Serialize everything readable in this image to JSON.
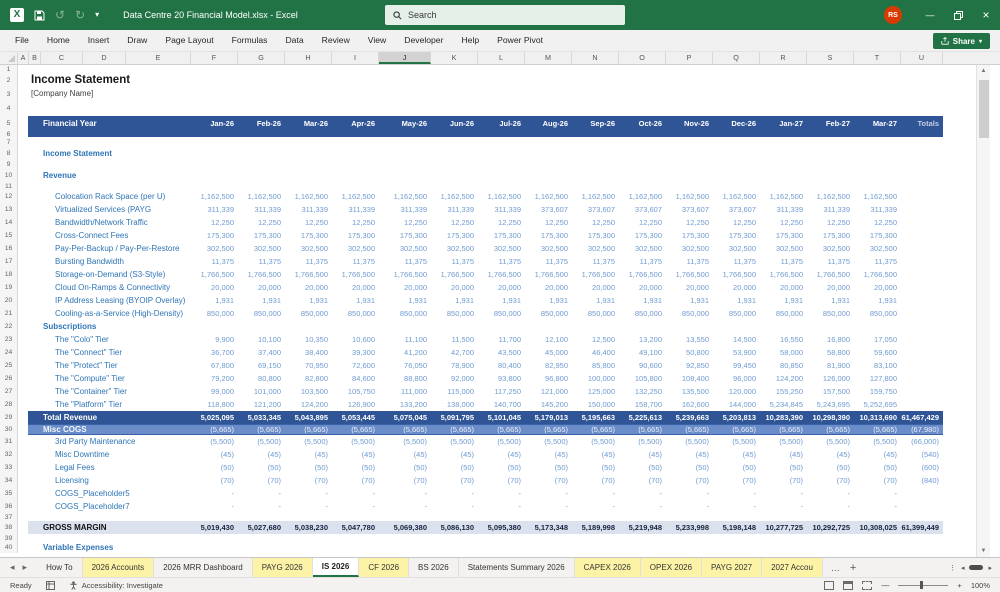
{
  "titlebar": {
    "title": "Data Centre 20 Financial Model.xlsx  -  Excel",
    "search_label": "Search",
    "avatar_initials": "RS"
  },
  "menubar": {
    "items": [
      "File",
      "Home",
      "Insert",
      "Draw",
      "Page Layout",
      "Formulas",
      "Data",
      "Review",
      "View",
      "Developer",
      "Help",
      "Power Pivot"
    ],
    "share_label": "Share"
  },
  "columns": {
    "letters": [
      "A",
      "B",
      "C",
      "D",
      "E",
      "F",
      "G",
      "H",
      "I",
      "J",
      "K",
      "L",
      "M",
      "N",
      "O",
      "P",
      "Q",
      "R",
      "S",
      "T",
      "U"
    ],
    "selected": "J"
  },
  "colors": {
    "excel_green": "#217346",
    "header_blue": "#2F5597",
    "cogs_fill": "#6A8CC8",
    "gross_margin_fill": "#DBE2EE",
    "section_text": "#2E75B6",
    "value_text": "#6F9BD2",
    "tab_yellow": "#FCF3A6",
    "avatar_orange": "#D83B01"
  },
  "glyphs": {
    "undo": "↺",
    "redo": "↻",
    "caret": "▾",
    "minimize": "—",
    "close": "×",
    "scroll_up": "▲",
    "scroll_down": "▼",
    "tab_left": "◂",
    "tab_right": "▸",
    "more_tabs": "…",
    "add_sheet": "+",
    "dots": "⋮",
    "zoom_out": "—",
    "zoom_in": "+"
  },
  "sheet": {
    "header": {
      "label": "Financial Year",
      "months": [
        "Jan-26",
        "Feb-26",
        "Mar-26",
        "Apr-26",
        "May-26",
        "Jun-26",
        "Jul-26",
        "Aug-26",
        "Sep-26",
        "Oct-26",
        "Nov-26",
        "Dec-26",
        "Jan-27",
        "Feb-27",
        "Mar-27"
      ],
      "totals_label": "Totals"
    },
    "rows": [
      {
        "n": 1,
        "type": "empty"
      },
      {
        "n": 2,
        "type": "title",
        "label": "Income Statement"
      },
      {
        "n": 3,
        "type": "subtitle",
        "label": "[Company Name]"
      },
      {
        "n": 4,
        "type": "empty"
      },
      {
        "n": 5,
        "type": "monthheader",
        "label": "Financial Year"
      },
      {
        "n": 6,
        "type": "band"
      },
      {
        "n": 7,
        "type": "empty"
      },
      {
        "n": 8,
        "type": "section",
        "label": "Income Statement"
      },
      {
        "n": 9,
        "type": "empty"
      },
      {
        "n": 10,
        "type": "section",
        "label": "Revenue"
      },
      {
        "n": 11,
        "type": "empty"
      },
      {
        "n": 12,
        "type": "item",
        "label": "Colocation Rack Space (per U)",
        "values": [
          "1,162,500",
          "1,162,500",
          "1,162,500",
          "1,162,500",
          "1,162,500",
          "1,162,500",
          "1,162,500",
          "1,162,500",
          "1,162,500",
          "1,162,500",
          "1,162,500",
          "1,162,500",
          "1,162,500",
          "1,162,500",
          "1,162,500"
        ],
        "total": ""
      },
      {
        "n": 13,
        "type": "item",
        "label": "Virtualized Services (PAYG",
        "values": [
          "311,339",
          "311,339",
          "311,339",
          "311,339",
          "311,339",
          "311,339",
          "311,339",
          "373,607",
          "373,607",
          "373,607",
          "373,607",
          "373,607",
          "311,339",
          "311,339",
          "311,339"
        ],
        "total": ""
      },
      {
        "n": 14,
        "type": "item",
        "label": "Bandwidth/Network Traffic",
        "values": [
          "12,250",
          "12,250",
          "12,250",
          "12,250",
          "12,250",
          "12,250",
          "12,250",
          "12,250",
          "12,250",
          "12,250",
          "12,250",
          "12,250",
          "12,250",
          "12,250",
          "12,250"
        ],
        "total": ""
      },
      {
        "n": 15,
        "type": "item",
        "label": "Cross-Connect Fees",
        "values": [
          "175,300",
          "175,300",
          "175,300",
          "175,300",
          "175,300",
          "175,300",
          "175,300",
          "175,300",
          "175,300",
          "175,300",
          "175,300",
          "175,300",
          "175,300",
          "175,300",
          "175,300"
        ],
        "total": ""
      },
      {
        "n": 16,
        "type": "item",
        "label": "Pay-Per-Backup / Pay-Per-Restore",
        "values": [
          "302,500",
          "302,500",
          "302,500",
          "302,500",
          "302,500",
          "302,500",
          "302,500",
          "302,500",
          "302,500",
          "302,500",
          "302,500",
          "302,500",
          "302,500",
          "302,500",
          "302,500"
        ],
        "total": ""
      },
      {
        "n": 17,
        "type": "item",
        "label": "Bursting Bandwidth",
        "values": [
          "11,375",
          "11,375",
          "11,375",
          "11,375",
          "11,375",
          "11,375",
          "11,375",
          "11,375",
          "11,375",
          "11,375",
          "11,375",
          "11,375",
          "11,375",
          "11,375",
          "11,375"
        ],
        "total": ""
      },
      {
        "n": 18,
        "type": "item",
        "label": "Storage-on-Demand (S3-Style)",
        "values": [
          "1,766,500",
          "1,766,500",
          "1,766,500",
          "1,766,500",
          "1,766,500",
          "1,766,500",
          "1,766,500",
          "1,766,500",
          "1,766,500",
          "1,766,500",
          "1,766,500",
          "1,766,500",
          "1,766,500",
          "1,766,500",
          "1,766,500"
        ],
        "total": ""
      },
      {
        "n": 19,
        "type": "item",
        "label": "Cloud On-Ramps & Connectivity",
        "values": [
          "20,000",
          "20,000",
          "20,000",
          "20,000",
          "20,000",
          "20,000",
          "20,000",
          "20,000",
          "20,000",
          "20,000",
          "20,000",
          "20,000",
          "20,000",
          "20,000",
          "20,000"
        ],
        "total": ""
      },
      {
        "n": 20,
        "type": "item",
        "label": "IP Address Leasing (BYOIP Overlay)",
        "values": [
          "1,931",
          "1,931",
          "1,931",
          "1,931",
          "1,931",
          "1,931",
          "1,931",
          "1,931",
          "1,931",
          "1,931",
          "1,931",
          "1,931",
          "1,931",
          "1,931",
          "1,931"
        ],
        "total": ""
      },
      {
        "n": 21,
        "type": "item",
        "label": "Cooling-as-a-Service (High-Density)",
        "values": [
          "850,000",
          "850,000",
          "850,000",
          "850,000",
          "850,000",
          "850,000",
          "850,000",
          "850,000",
          "850,000",
          "850,000",
          "850,000",
          "850,000",
          "850,000",
          "850,000",
          "850,000"
        ],
        "total": ""
      },
      {
        "n": 22,
        "type": "section",
        "label": "Subscriptions"
      },
      {
        "n": 23,
        "type": "item",
        "label": "The \"Colo\" Tier",
        "values": [
          "9,900",
          "10,100",
          "10,350",
          "10,600",
          "11,100",
          "11,500",
          "11,700",
          "12,100",
          "12,500",
          "13,200",
          "13,550",
          "14,500",
          "16,550",
          "16,800",
          "17,050"
        ],
        "total": ""
      },
      {
        "n": 24,
        "type": "item",
        "label": "The \"Connect\" Tier",
        "values": [
          "36,700",
          "37,400",
          "38,400",
          "39,300",
          "41,200",
          "42,700",
          "43,500",
          "45,000",
          "46,400",
          "49,100",
          "50,800",
          "53,900",
          "58,000",
          "58,800",
          "59,600"
        ],
        "total": ""
      },
      {
        "n": 25,
        "type": "item",
        "label": "The \"Protect\" Tier",
        "values": [
          "67,800",
          "69,150",
          "70,950",
          "72,600",
          "76,050",
          "78,900",
          "80,400",
          "82,950",
          "85,800",
          "90,600",
          "92,850",
          "99,450",
          "80,850",
          "81,900",
          "83,100"
        ],
        "total": ""
      },
      {
        "n": 26,
        "type": "item",
        "label": "The \"Compute\" Tier",
        "values": [
          "79,200",
          "80,800",
          "82,800",
          "84,600",
          "88,800",
          "92,000",
          "93,800",
          "96,800",
          "100,000",
          "105,800",
          "108,400",
          "96,000",
          "124,200",
          "126,000",
          "127,800"
        ],
        "total": ""
      },
      {
        "n": 27,
        "type": "item",
        "label": "The \"Container\" Tier",
        "values": [
          "99,000",
          "101,000",
          "103,500",
          "105,750",
          "111,000",
          "115,000",
          "117,250",
          "121,000",
          "125,000",
          "132,250",
          "135,500",
          "120,000",
          "155,250",
          "157,500",
          "159,750"
        ],
        "total": ""
      },
      {
        "n": 28,
        "type": "item",
        "label": "The \"Platform\" Tier",
        "values": [
          "118,800",
          "121,200",
          "124,200",
          "126,900",
          "133,200",
          "138,000",
          "140,700",
          "145,200",
          "150,000",
          "158,700",
          "162,600",
          "144,000",
          "5,234,845",
          "5,243,695",
          "5,252,695"
        ],
        "total": ""
      },
      {
        "n": 29,
        "type": "total",
        "label": "Total Revenue",
        "values": [
          "5,025,095",
          "5,033,345",
          "5,043,895",
          "5,053,445",
          "5,075,045",
          "5,091,795",
          "5,101,045",
          "5,179,013",
          "5,195,663",
          "5,225,613",
          "5,239,663",
          "5,203,813",
          "10,283,390",
          "10,298,390",
          "10,313,690"
        ],
        "total": "61,467,429"
      },
      {
        "n": 30,
        "type": "cogs",
        "label": "Misc COGS",
        "values": [
          "(5,665)",
          "(5,665)",
          "(5,665)",
          "(5,665)",
          "(5,665)",
          "(5,665)",
          "(5,665)",
          "(5,665)",
          "(5,665)",
          "(5,665)",
          "(5,665)",
          "(5,665)",
          "(5,665)",
          "(5,665)",
          "(5,665)"
        ],
        "total": "(67,980)"
      },
      {
        "n": 31,
        "type": "item",
        "label": "3rd Party Maintenance",
        "values": [
          "(5,500)",
          "(5,500)",
          "(5,500)",
          "(5,500)",
          "(5,500)",
          "(5,500)",
          "(5,500)",
          "(5,500)",
          "(5,500)",
          "(5,500)",
          "(5,500)",
          "(5,500)",
          "(5,500)",
          "(5,500)",
          "(5,500)"
        ],
        "total": "(66,000)"
      },
      {
        "n": 32,
        "type": "item",
        "label": "Misc Downtime",
        "values": [
          "(45)",
          "(45)",
          "(45)",
          "(45)",
          "(45)",
          "(45)",
          "(45)",
          "(45)",
          "(45)",
          "(45)",
          "(45)",
          "(45)",
          "(45)",
          "(45)",
          "(45)"
        ],
        "total": "(540)"
      },
      {
        "n": 33,
        "type": "item",
        "label": "Legal Fees",
        "values": [
          "(50)",
          "(50)",
          "(50)",
          "(50)",
          "(50)",
          "(50)",
          "(50)",
          "(50)",
          "(50)",
          "(50)",
          "(50)",
          "(50)",
          "(50)",
          "(50)",
          "(50)"
        ],
        "total": "(600)"
      },
      {
        "n": 34,
        "type": "item",
        "label": "Licensing",
        "values": [
          "(70)",
          "(70)",
          "(70)",
          "(70)",
          "(70)",
          "(70)",
          "(70)",
          "(70)",
          "(70)",
          "(70)",
          "(70)",
          "(70)",
          "(70)",
          "(70)",
          "(70)"
        ],
        "total": "(840)"
      },
      {
        "n": 35,
        "type": "item",
        "label": "COGS_Placeholder5",
        "values": [
          "-",
          "-",
          "-",
          "-",
          "-",
          "-",
          "-",
          "-",
          "-",
          "-",
          "-",
          "-",
          "-",
          "-",
          "-"
        ],
        "total": ""
      },
      {
        "n": 36,
        "type": "item",
        "label": "COGS_Placeholder7",
        "values": [
          "-",
          "-",
          "-",
          "-",
          "-",
          "-",
          "-",
          "-",
          "-",
          "-",
          "-",
          "-",
          "-",
          "-",
          "-"
        ],
        "total": ""
      },
      {
        "n": 37,
        "type": "empty"
      },
      {
        "n": 38,
        "type": "gm",
        "label": "GROSS MARGIN",
        "values": [
          "5,019,430",
          "5,027,680",
          "5,038,230",
          "5,047,780",
          "5,069,380",
          "5,086,130",
          "5,095,380",
          "5,173,348",
          "5,189,998",
          "5,219,948",
          "5,233,998",
          "5,198,148",
          "10,277,725",
          "10,292,725",
          "10,308,025"
        ],
        "total": "61,399,449"
      },
      {
        "n": 39,
        "type": "empty"
      },
      {
        "n": 40,
        "type": "section",
        "label": "Variable Expenses"
      }
    ]
  },
  "tabs": {
    "items": [
      {
        "label": "How To",
        "style": "plain"
      },
      {
        "label": "2026 Accounts",
        "style": "yellow"
      },
      {
        "label": "2026 MRR Dashboard",
        "style": "plain"
      },
      {
        "label": "PAYG 2026",
        "style": "yellow"
      },
      {
        "label": "IS 2026",
        "style": "active"
      },
      {
        "label": "CF 2026",
        "style": "yellow"
      },
      {
        "label": "BS 2026",
        "style": "plain"
      },
      {
        "label": "Statements Summary 2026",
        "style": "plain"
      },
      {
        "label": "CAPEX 2026",
        "style": "yellow"
      },
      {
        "label": "OPEX 2026",
        "style": "yellow"
      },
      {
        "label": "PAYG 2027",
        "style": "yellow"
      },
      {
        "label": "2027 Accou",
        "style": "yellow"
      }
    ]
  },
  "statusbar": {
    "ready": "Ready",
    "accessibility": "Accessibility: Investigate",
    "zoom_level": "100%"
  }
}
